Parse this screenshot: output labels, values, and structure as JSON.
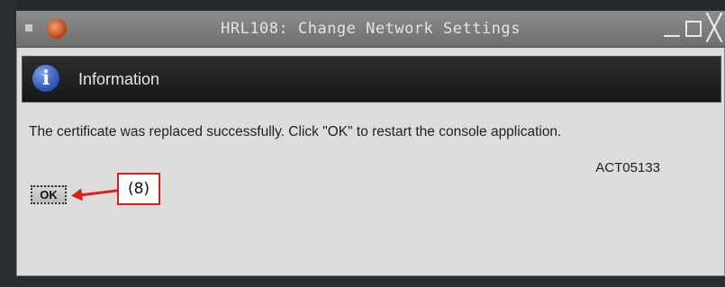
{
  "window": {
    "title": "HRL108: Change Network Settings",
    "menu_icon": "window-menu-icon",
    "app_icon": "app-logo-icon",
    "controls": {
      "minimize": "minimize-icon",
      "maximize": "maximize-icon",
      "close_glyph": "╳"
    }
  },
  "dialog": {
    "header": {
      "icon_glyph": "i",
      "icon": "info-icon",
      "title": "Information"
    },
    "message": "The certificate was replaced successfully. Click \"OK\" to restart the console application.",
    "code": "ACT05133",
    "ok_label": "OK"
  },
  "annotation": {
    "label": "(8)",
    "color": "#e21b1b"
  },
  "colors": {
    "titlebar": "#6e6e6c",
    "header_bg": "#151718",
    "dialog_bg": "#dcdcda",
    "info_icon": "#2f57b5"
  }
}
